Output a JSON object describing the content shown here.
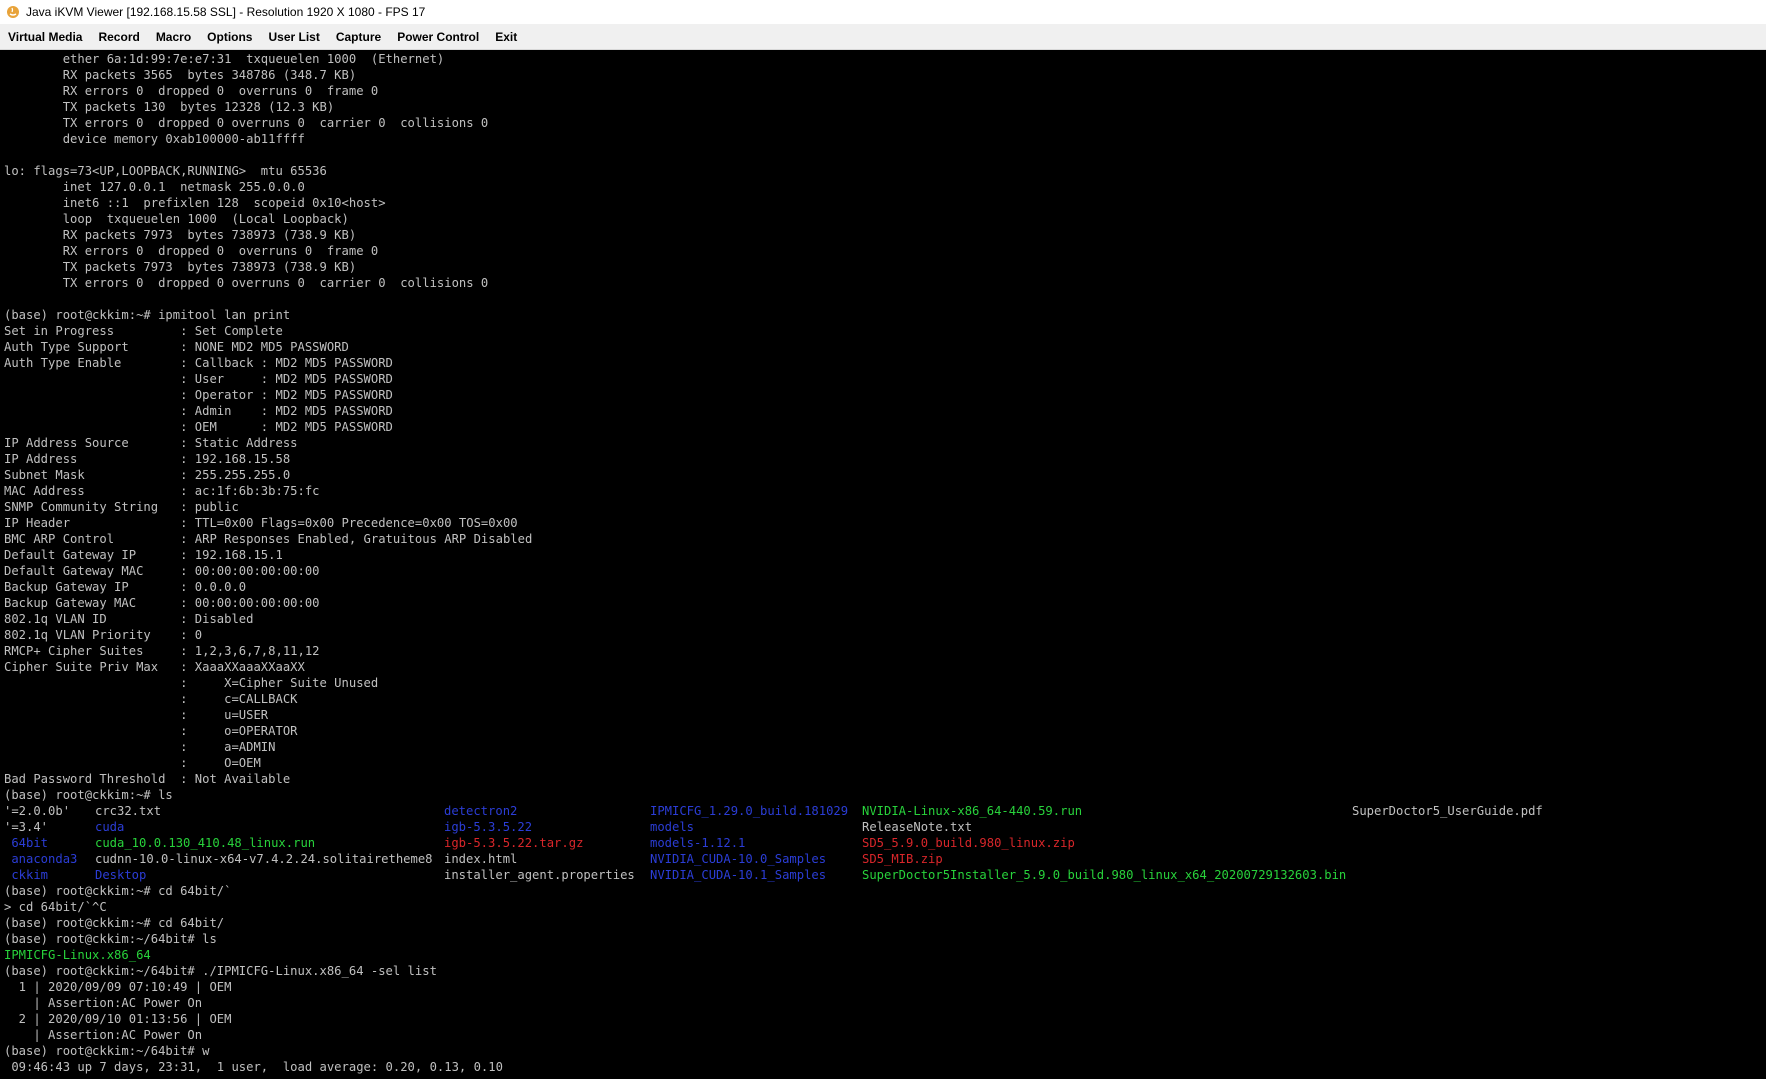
{
  "window": {
    "title": "Java iKVM Viewer  [192.168.15.58 SSL]  - Resolution 1920 X 1080 - FPS 17"
  },
  "menu": {
    "items": [
      "Virtual Media",
      "Record",
      "Macro",
      "Options",
      "User List",
      "Capture",
      "Power Control",
      "Exit"
    ]
  },
  "terminal": {
    "lines_before": [
      "        ether 6a:1d:99:7e:e7:31  txqueuelen 1000  (Ethernet)",
      "        RX packets 3565  bytes 348786 (348.7 KB)",
      "        RX errors 0  dropped 0  overruns 0  frame 0",
      "        TX packets 130  bytes 12328 (12.3 KB)",
      "        TX errors 0  dropped 0 overruns 0  carrier 0  collisions 0",
      "        device memory 0xab100000-ab11ffff",
      "",
      "lo: flags=73<UP,LOOPBACK,RUNNING>  mtu 65536",
      "        inet 127.0.0.1  netmask 255.0.0.0",
      "        inet6 ::1  prefixlen 128  scopeid 0x10<host>",
      "        loop  txqueuelen 1000  (Local Loopback)",
      "        RX packets 7973  bytes 738973 (738.9 KB)",
      "        RX errors 0  dropped 0  overruns 0  frame 0",
      "        TX packets 7973  bytes 738973 (738.9 KB)",
      "        TX errors 0  dropped 0 overruns 0  carrier 0  collisions 0",
      "",
      "(base) root@ckkim:~# ipmitool lan print",
      "Set in Progress         : Set Complete",
      "Auth Type Support       : NONE MD2 MD5 PASSWORD",
      "Auth Type Enable        : Callback : MD2 MD5 PASSWORD",
      "                        : User     : MD2 MD5 PASSWORD",
      "                        : Operator : MD2 MD5 PASSWORD",
      "                        : Admin    : MD2 MD5 PASSWORD",
      "                        : OEM      : MD2 MD5 PASSWORD",
      "IP Address Source       : Static Address",
      "IP Address              : 192.168.15.58",
      "Subnet Mask             : 255.255.255.0",
      "MAC Address             : ac:1f:6b:3b:75:fc",
      "SNMP Community String   : public",
      "IP Header               : TTL=0x00 Flags=0x00 Precedence=0x00 TOS=0x00",
      "BMC ARP Control         : ARP Responses Enabled, Gratuitous ARP Disabled",
      "Default Gateway IP      : 192.168.15.1",
      "Default Gateway MAC     : 00:00:00:00:00:00",
      "Backup Gateway IP       : 0.0.0.0",
      "Backup Gateway MAC      : 00:00:00:00:00:00",
      "802.1q VLAN ID          : Disabled",
      "802.1q VLAN Priority    : 0",
      "RMCP+ Cipher Suites     : 1,2,3,6,7,8,11,12",
      "Cipher Suite Priv Max   : XaaaXXaaaXXaaXX",
      "                        :     X=Cipher Suite Unused",
      "                        :     c=CALLBACK",
      "                        :     u=USER",
      "                        :     o=OPERATOR",
      "                        :     a=ADMIN",
      "                        :     O=OEM",
      "Bad Password Threshold  : Not Available",
      "(base) root@ckkim:~# ls"
    ],
    "ls_rows": [
      [
        {
          "text": "'=2.0.0b'",
          "color": "white"
        },
        {
          "text": "crc32.txt",
          "color": "white"
        },
        {
          "text": "detectron2",
          "color": "blue"
        },
        {
          "text": "IPMICFG_1.29.0_build.181029",
          "color": "blue"
        },
        {
          "text": "NVIDIA-Linux-x86_64-440.59.run",
          "color": "green"
        },
        {
          "text": "SuperDoctor5_UserGuide.pdf",
          "color": "white"
        }
      ],
      [
        {
          "text": "'=3.4'",
          "color": "white"
        },
        {
          "text": "cuda",
          "color": "blue"
        },
        {
          "text": "igb-5.3.5.22",
          "color": "blue"
        },
        {
          "text": "models",
          "color": "blue"
        },
        {
          "text": "ReleaseNote.txt",
          "color": "white"
        },
        {
          "text": "",
          "color": "white"
        }
      ],
      [
        {
          "text": " 64bit",
          "color": "blue"
        },
        {
          "text": "cuda_10.0.130_410.48_linux.run",
          "color": "green"
        },
        {
          "text": "igb-5.3.5.22.tar.gz",
          "color": "red"
        },
        {
          "text": "models-1.12.1",
          "color": "blue"
        },
        {
          "text": "SD5_5.9.0_build.980_linux.zip",
          "color": "red"
        },
        {
          "text": "",
          "color": "white"
        }
      ],
      [
        {
          "text": " anaconda3",
          "color": "blue"
        },
        {
          "text": "cudnn-10.0-linux-x64-v7.4.2.24.solitairetheme8",
          "color": "white"
        },
        {
          "text": "index.html",
          "color": "white"
        },
        {
          "text": "NVIDIA_CUDA-10.0_Samples",
          "color": "blue"
        },
        {
          "text": "SD5_MIB.zip",
          "color": "red"
        },
        {
          "text": "",
          "color": "white"
        }
      ],
      [
        {
          "text": " ckkim",
          "color": "blue"
        },
        {
          "text": "Desktop",
          "color": "blue"
        },
        {
          "text": "installer_agent.properties",
          "color": "white"
        },
        {
          "text": "NVIDIA_CUDA-10.1_Samples",
          "color": "blue"
        },
        {
          "text": "SuperDoctor5Installer_5.9.0_build.980_linux_x64_20200729132603.bin",
          "color": "green"
        },
        {
          "text": "",
          "color": "white"
        }
      ]
    ],
    "lines_after": [
      {
        "text": "(base) root@ckkim:~# cd 64bit/`",
        "color": "white"
      },
      {
        "text": "> cd 64bit/`^C",
        "color": "white"
      },
      {
        "text": "(base) root@ckkim:~# cd 64bit/",
        "color": "white"
      },
      {
        "text": "(base) root@ckkim:~/64bit# ls",
        "color": "white"
      },
      {
        "text": "IPMICFG-Linux.x86_64",
        "color": "green"
      },
      {
        "text": "(base) root@ckkim:~/64bit# ./IPMICFG-Linux.x86_64 -sel list",
        "color": "white"
      },
      {
        "text": "  1 | 2020/09/09 07:10:49 | OEM",
        "color": "white"
      },
      {
        "text": "    | Assertion:AC Power On",
        "color": "white"
      },
      {
        "text": "  2 | 2020/09/10 01:13:56 | OEM",
        "color": "white"
      },
      {
        "text": "    | Assertion:AC Power On",
        "color": "white"
      },
      {
        "text": "(base) root@ckkim:~/64bit# w",
        "color": "white"
      },
      {
        "text": " 09:46:43 up 7 days, 23:31,  1 user,  load average: 0.20, 0.13, 0.10",
        "color": "white"
      }
    ]
  },
  "colors": {
    "white": "#c0c0c0",
    "blue": "#2b3dd6",
    "green": "#28d23b",
    "red": "#d8262a"
  }
}
